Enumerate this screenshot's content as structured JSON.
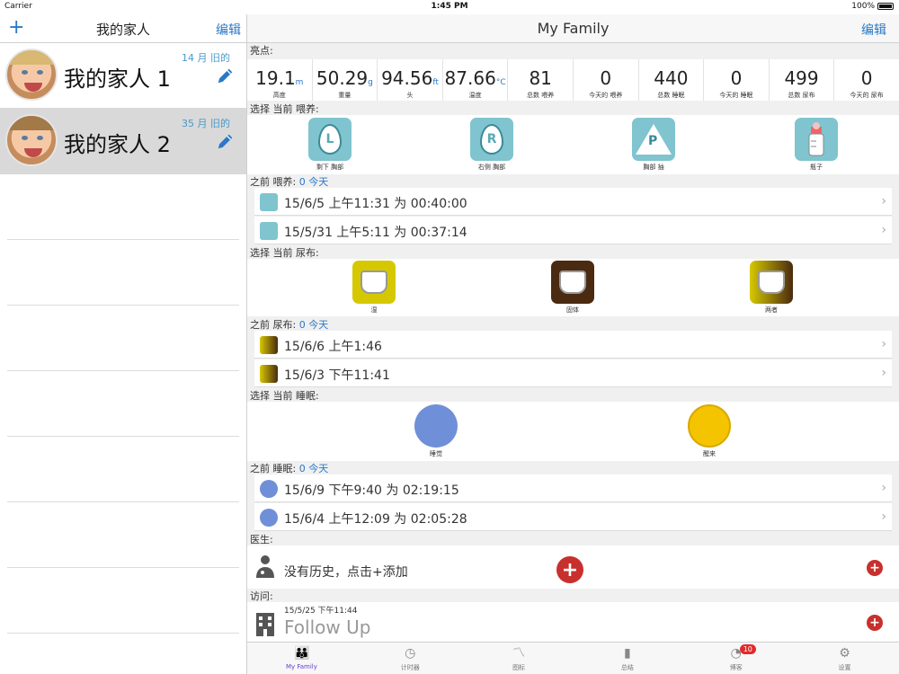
{
  "status": {
    "carrier": "Carrier",
    "time": "1:45 PM",
    "battery": "100%"
  },
  "left": {
    "add_label": "+",
    "title": "我的家人",
    "edit_label": "编辑",
    "members": [
      {
        "name": "我的家人 1",
        "age": "14 月 旧的"
      },
      {
        "name": "我的家人 2",
        "age": "35 月 旧的"
      }
    ]
  },
  "right": {
    "title": "My Family",
    "edit_label": "编辑",
    "highlights_label": "亮点:",
    "stats": [
      {
        "value": "19.1",
        "unit": "m",
        "label": "高度"
      },
      {
        "value": "50.29",
        "unit": "g",
        "label": "重量"
      },
      {
        "value": "94.56",
        "unit": "ft",
        "label": "头"
      },
      {
        "value": "87.66",
        "unit": "°C",
        "label": "温度"
      },
      {
        "value": "81",
        "unit": "",
        "label": "总数 喂养"
      },
      {
        "value": "0",
        "unit": "",
        "label": "今天的 喂养"
      },
      {
        "value": "440",
        "unit": "",
        "label": "总数 睡眠"
      },
      {
        "value": "0",
        "unit": "",
        "label": "今天的 睡眠"
      },
      {
        "value": "499",
        "unit": "",
        "label": "总数 尿布"
      },
      {
        "value": "0",
        "unit": "",
        "label": "今天的 尿布"
      }
    ],
    "feeding": {
      "select_label": "选择 当前 喂养:",
      "options": [
        {
          "icon": "left-breast-icon",
          "letter": "L",
          "label": "剩下 胸部"
        },
        {
          "icon": "right-breast-icon",
          "letter": "R",
          "label": "右侧 胸部"
        },
        {
          "icon": "pump-icon",
          "letter": "P",
          "label": "胸部 抽"
        },
        {
          "icon": "bottle-icon",
          "letter": "",
          "label": "瓶子"
        }
      ],
      "prev_label": "之前 喂养:",
      "prev_today": "0 今天",
      "history": [
        {
          "icon": "R",
          "text": "15/6/5 上午11:31 为 00:40:00"
        },
        {
          "icon": "P",
          "text": "15/5/31 上午5:11 为 00:37:14"
        }
      ]
    },
    "diaper": {
      "select_label": "选择 当前 尿布:",
      "options": [
        {
          "icon": "wet-diaper-icon",
          "label": "湿",
          "color": "#d6c800"
        },
        {
          "icon": "solid-diaper-icon",
          "label": "固体",
          "color": "#4a2a10"
        },
        {
          "icon": "both-diaper-icon",
          "label": "两者",
          "color": "#b8a000"
        }
      ],
      "prev_label": "之前 尿布:",
      "prev_today": "0 今天",
      "history": [
        {
          "text": "15/6/6 上午1:46"
        },
        {
          "text": "15/6/3 下午11:41"
        }
      ]
    },
    "sleep": {
      "select_label": "选择 当前 睡眠:",
      "options": [
        {
          "icon": "sleeping-face-icon",
          "label": "睡觉"
        },
        {
          "icon": "smiley-face-icon",
          "label": "醒来"
        }
      ],
      "prev_label": "之前 睡眠:",
      "prev_today": "0 今天",
      "history": [
        {
          "text": "15/6/9 下午9:40 为 02:19:15"
        },
        {
          "text": "15/6/4 上午12:09 为 02:05:28"
        }
      ]
    },
    "doctor": {
      "label": "医生:",
      "empty_text": "没有历史，点击+添加"
    },
    "visit": {
      "label": "访问:",
      "date": "15/5/25 下午11:44",
      "title": "Follow Up"
    }
  },
  "tabs": [
    {
      "label": "My Family",
      "icon": "family-icon",
      "glyph": "👪"
    },
    {
      "label": "计时器",
      "icon": "timer-icon",
      "glyph": "◷"
    },
    {
      "label": "图标",
      "icon": "chart-icon",
      "glyph": "〽"
    },
    {
      "label": "总结",
      "icon": "bookmark-icon",
      "glyph": "▮"
    },
    {
      "label": "博客",
      "icon": "rss-icon",
      "glyph": "◔",
      "badge": "10"
    },
    {
      "label": "设置",
      "icon": "gear-icon",
      "glyph": "⚙"
    }
  ]
}
